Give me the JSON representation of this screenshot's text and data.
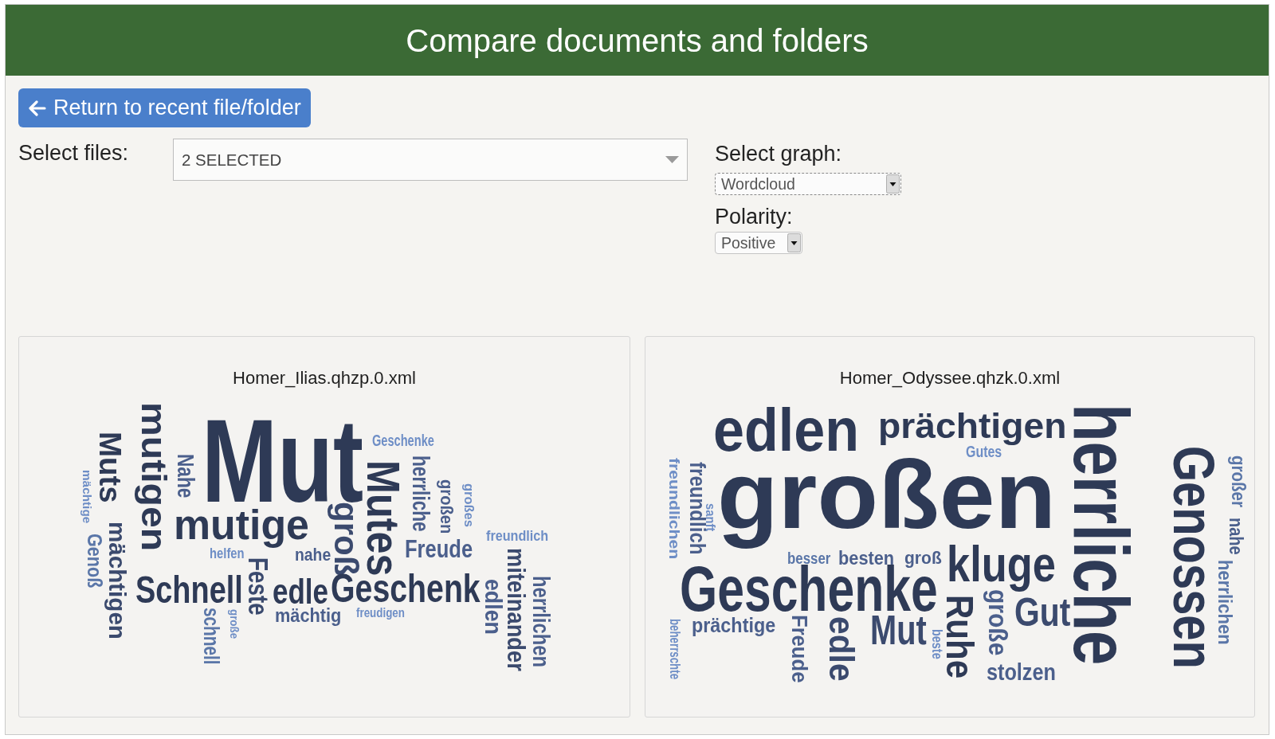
{
  "header": {
    "title": "Compare documents and folders"
  },
  "back_button": {
    "label": "Return to recent file/folder"
  },
  "files_select": {
    "label": "Select files:",
    "value": "2 SELECTED"
  },
  "graph_select": {
    "label": "Select graph:",
    "value": "Wordcloud",
    "focused": true
  },
  "polarity_select": {
    "label": "Polarity:",
    "value": "Positive",
    "focused": false
  },
  "panels": [
    {
      "title": "Homer_Ilias.qhzp.0.xml",
      "words": [
        {
          "text": "Muts",
          "color": "#2e3a56"
        },
        {
          "text": "mutigen",
          "color": "#2e3a56"
        },
        {
          "text": "Mut",
          "color": "#2e3a56"
        },
        {
          "text": "Geschenke",
          "color": "#6e8ec6"
        },
        {
          "text": "mächtige",
          "color": "#6e8ec6"
        },
        {
          "text": "Nahe",
          "color": "#4b5f8c"
        },
        {
          "text": "Mutes",
          "color": "#2e3a56"
        },
        {
          "text": "herrliche",
          "color": "#4b5f8c"
        },
        {
          "text": "großen",
          "color": "#4b5f8c"
        },
        {
          "text": "großes",
          "color": "#6e8ec6"
        },
        {
          "text": "Genoß",
          "color": "#5a76a8"
        },
        {
          "text": "mächtigen",
          "color": "#3b4a6e"
        },
        {
          "text": "mutige",
          "color": "#2e3a56"
        },
        {
          "text": "helfen",
          "color": "#6e8ec6"
        },
        {
          "text": "Feste",
          "color": "#3b4a6e"
        },
        {
          "text": "nahe",
          "color": "#4b5f8c"
        },
        {
          "text": "groß",
          "color": "#3b4a6e"
        },
        {
          "text": "Freude",
          "color": "#4b5f8c"
        },
        {
          "text": "freundlich",
          "color": "#6e8ec6"
        },
        {
          "text": "Schnell",
          "color": "#2e3a56"
        },
        {
          "text": "edle",
          "color": "#2e3a56"
        },
        {
          "text": "Geschenk",
          "color": "#2e3a56"
        },
        {
          "text": "schnell",
          "color": "#5a76a8"
        },
        {
          "text": "große",
          "color": "#6e8ec6"
        },
        {
          "text": "mächtig",
          "color": "#4b5f8c"
        },
        {
          "text": "freudigen",
          "color": "#6e8ec6"
        },
        {
          "text": "edlen",
          "color": "#4b5f8c"
        },
        {
          "text": "miteinander",
          "color": "#3b4a6e"
        },
        {
          "text": "herrlichen",
          "color": "#4b5f8c"
        }
      ]
    },
    {
      "title": "Homer_Odyssee.qhzk.0.xml",
      "words": [
        {
          "text": "edlen",
          "color": "#2e3a56"
        },
        {
          "text": "prächtigen",
          "color": "#2e3a56"
        },
        {
          "text": "Gutes",
          "color": "#6e8ec6"
        },
        {
          "text": "freundlichen",
          "color": "#6e8ec6"
        },
        {
          "text": "freundlich",
          "color": "#4b5f8c"
        },
        {
          "text": "sanft",
          "color": "#6e8ec6"
        },
        {
          "text": "großen",
          "color": "#2e3a56"
        },
        {
          "text": "besser",
          "color": "#5a76a8"
        },
        {
          "text": "besten",
          "color": "#4b5f8c"
        },
        {
          "text": "groß",
          "color": "#4b5f8c"
        },
        {
          "text": "Geschenke",
          "color": "#2e3a56"
        },
        {
          "text": "kluge",
          "color": "#2e3a56"
        },
        {
          "text": "beherrschte",
          "color": "#6e8ec6"
        },
        {
          "text": "prächtige",
          "color": "#4b5f8c"
        },
        {
          "text": "Freude",
          "color": "#4b5f8c"
        },
        {
          "text": "edle",
          "color": "#3b4a6e"
        },
        {
          "text": "Mut",
          "color": "#3b4a6e"
        },
        {
          "text": "beste",
          "color": "#6e8ec6"
        },
        {
          "text": "Ruhe",
          "color": "#2e3a56"
        },
        {
          "text": "große",
          "color": "#4b5f8c"
        },
        {
          "text": "Gut",
          "color": "#3b4a6e"
        },
        {
          "text": "stolzen",
          "color": "#4b5f8c"
        },
        {
          "text": "herrliche",
          "color": "#2e3a56"
        },
        {
          "text": "Genossen",
          "color": "#2e3a56"
        },
        {
          "text": "großer",
          "color": "#5a76a8"
        },
        {
          "text": "nahe",
          "color": "#4b5f8c"
        },
        {
          "text": "herrlichen",
          "color": "#5a76a8"
        }
      ]
    }
  ]
}
